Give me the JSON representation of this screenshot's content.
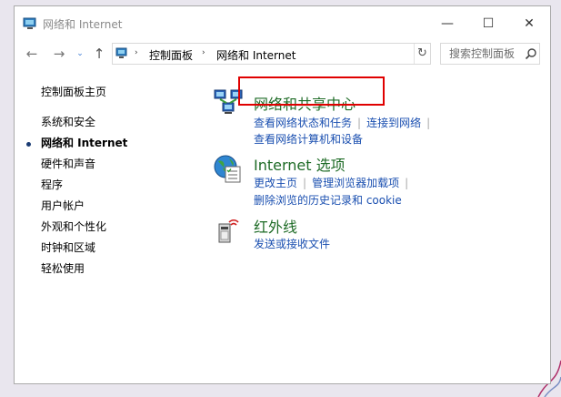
{
  "window": {
    "title": "网络和 Internet",
    "minimize_glyph": "—",
    "maximize_glyph": "☐",
    "close_glyph": "✕"
  },
  "addressbar": {
    "back_glyph": "←",
    "forward_glyph": "→",
    "recent_glyph": "⌄",
    "up_glyph": "↑",
    "crumbs": [
      "控制面板",
      "网络和 Internet"
    ],
    "crumb_separator": "›",
    "refresh_glyph": "↻"
  },
  "search": {
    "placeholder": "搜索控制面板"
  },
  "left_nav": {
    "home": "控制面板主页",
    "items": [
      {
        "label": "系统和安全"
      },
      {
        "label": "网络和 Internet",
        "current": true
      },
      {
        "label": "硬件和声音"
      },
      {
        "label": "程序"
      },
      {
        "label": "用户帐户"
      },
      {
        "label": "外观和个性化"
      },
      {
        "label": "时钟和区域"
      },
      {
        "label": "轻松使用"
      }
    ]
  },
  "sections": [
    {
      "title": "网络和共享中心",
      "icon": "network-sharing-center-icon",
      "highlighted": true,
      "link_rows": [
        [
          "查看网络状态和任务",
          "连接到网络"
        ],
        [
          "查看网络计算机和设备"
        ]
      ]
    },
    {
      "title": "Internet 选项",
      "icon": "internet-options-icon",
      "link_rows": [
        [
          "更改主页",
          "管理浏览器加载项"
        ],
        [
          "删除浏览的历史记录和 cookie"
        ]
      ]
    },
    {
      "title": "红外线",
      "icon": "infrared-icon",
      "link_rows": [
        [
          "发送或接收文件"
        ]
      ]
    }
  ],
  "colors": {
    "section_title": "#1e6b26",
    "link": "#1a4fb0",
    "highlight": "#e00000"
  }
}
